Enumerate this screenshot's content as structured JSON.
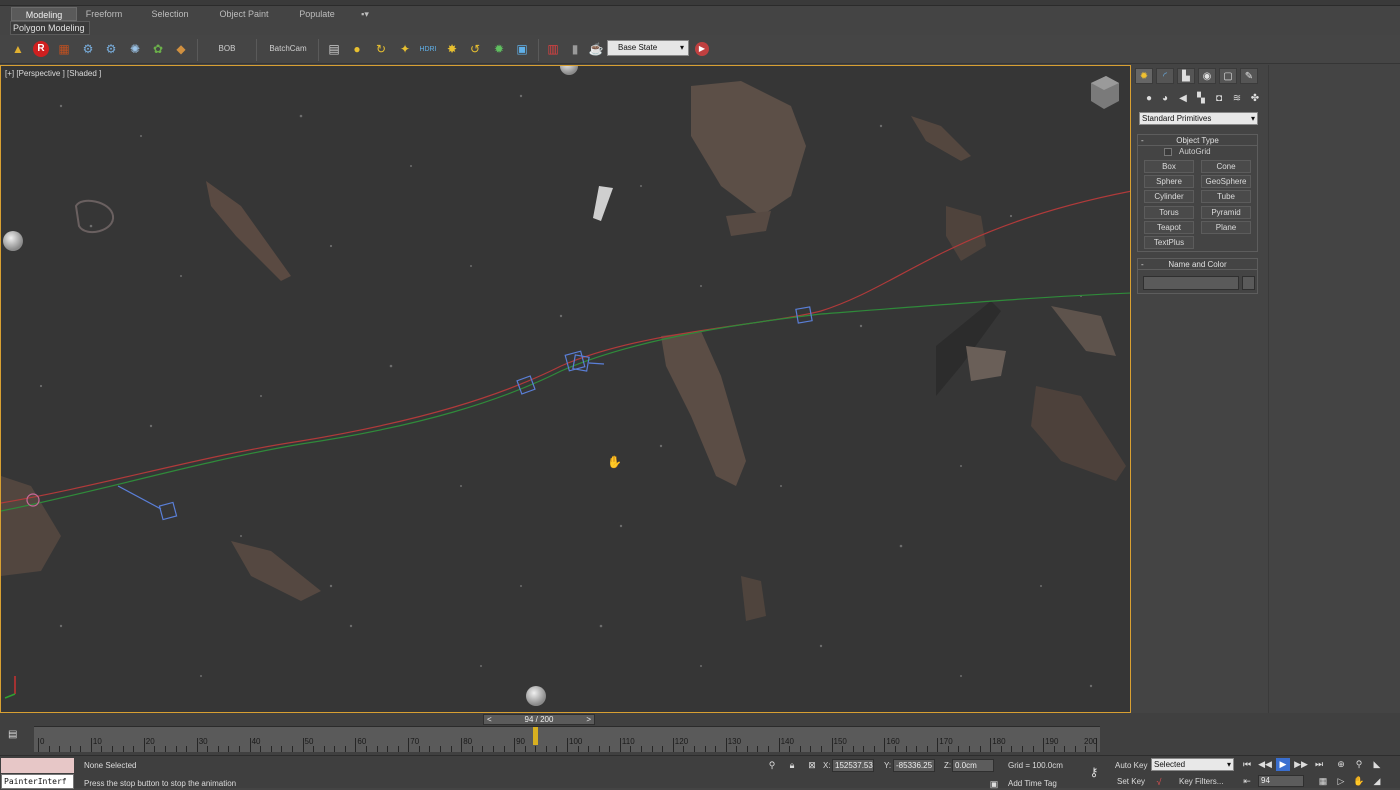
{
  "ribbon": {
    "tabs": [
      {
        "label": "Modeling",
        "active": true
      },
      {
        "label": "Freeform",
        "active": false
      },
      {
        "label": "Selection",
        "active": false
      },
      {
        "label": "Object Paint",
        "active": false
      },
      {
        "label": "Populate",
        "active": false
      }
    ],
    "sub_tab": "Polygon Modeling"
  },
  "toolbar": {
    "bob_label": "BOB",
    "batchcam_label": "BatchCam",
    "icons": [
      "render-setup-icon",
      "redshift-icon",
      "material-icon",
      "gear-icon",
      "gear-icon",
      "fish-icon",
      "plant-icon",
      "box-icon",
      "table-icon",
      "sun-icon",
      "hdri-icon",
      "hdri-icon",
      "hdri-icon",
      "hdri-icon",
      "hdri-icon",
      "hdri-icon",
      "hdri-icon",
      "layers-icon",
      "teapot-icon",
      "play-icon"
    ],
    "state_set": "Base State"
  },
  "viewport": {
    "label": "[+] [Perspective ] [Shaded ]"
  },
  "command_panel": {
    "dropdown": "Standard Primitives",
    "object_type": {
      "title": "Object Type",
      "autogrid": "AutoGrid",
      "buttons": [
        "Box",
        "Cone",
        "Sphere",
        "GeoSphere",
        "Cylinder",
        "Tube",
        "Torus",
        "Pyramid",
        "Teapot",
        "Plane",
        "TextPlus"
      ]
    },
    "name_and_color": {
      "title": "Name and Color"
    },
    "colors": {
      "swatch": "#5a5a5a"
    }
  },
  "timeline": {
    "slider": "94 / 200",
    "prev": "<",
    "next": ">",
    "labels": [
      "0",
      "10",
      "20",
      "30",
      "40",
      "50",
      "60",
      "70",
      "80",
      "90",
      "100",
      "110",
      "120",
      "130",
      "140",
      "150",
      "160",
      "170",
      "180",
      "190",
      "200"
    ],
    "current_frame": 94
  },
  "status": {
    "maxscript_listener": "PainterInterf",
    "selection": "None Selected",
    "prompt": "Press the stop button to stop the animation",
    "x_label": "X:",
    "x_value": "152537.53",
    "y_label": "Y:",
    "y_value": "-85336.25",
    "z_label": "Z:",
    "z_value": "0.0cm",
    "grid": "Grid = 100.0cm",
    "add_time_tag": "Add Time Tag",
    "auto_key": "Auto Key",
    "set_key": "Set Key",
    "key_mode": "Selected",
    "key_filters": "Key Filters...",
    "frame_field": "94"
  },
  "colors": {
    "viewport_border": "#d8a032",
    "path_red": "#b03a3a",
    "path_green": "#2f8a3a",
    "helper_blue": "#5a7fd8"
  }
}
